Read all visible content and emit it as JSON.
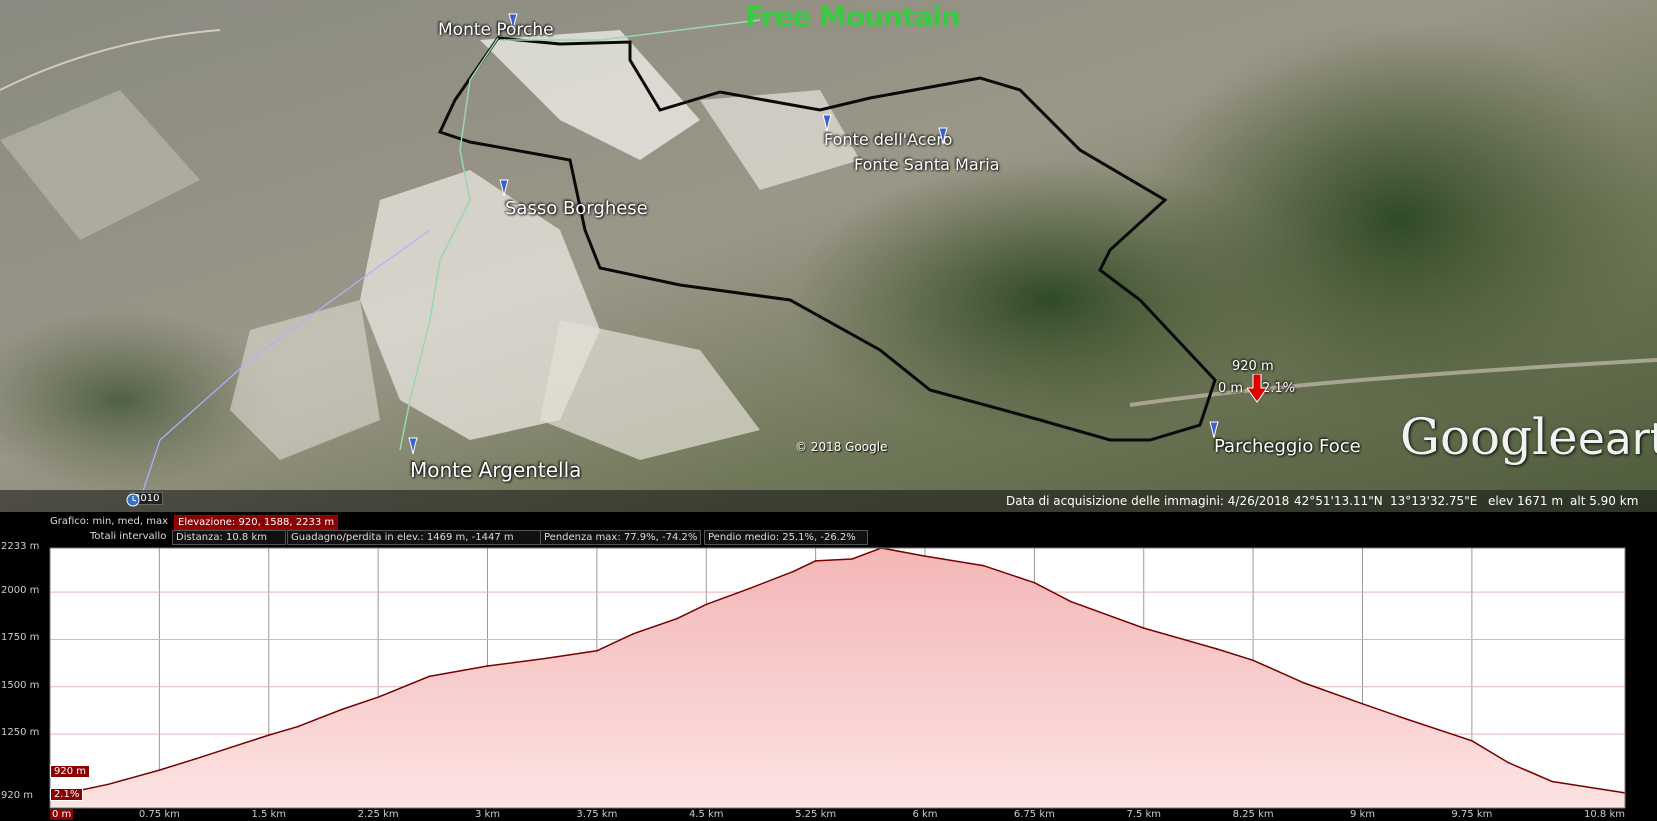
{
  "map": {
    "watermark": "Free Mountain",
    "copyright": "© 2018 Google",
    "logo": {
      "google": "Google",
      "earth": "earth"
    },
    "placemarks": [
      {
        "label": "Monte Porche"
      },
      {
        "label": "Fonte dell'Acero"
      },
      {
        "label": "Fonte Santa Maria"
      },
      {
        "label": "Sasso Borghese"
      },
      {
        "label": "Monte Argentella"
      },
      {
        "label": "Parcheggio Foce"
      }
    ],
    "cursor": {
      "elevation": "920 m",
      "distance": "0 m",
      "slope": "2.1%"
    },
    "history_year": "2010",
    "status": {
      "acquisition": "Data di acquisizione delle immagini: 4/26/2018",
      "lat": "42°51'13.11\"N",
      "lon": "13°13'32.75\"E",
      "elev": "elev  1671 m",
      "alt": "alt  5.90 km"
    }
  },
  "profile_header": {
    "grafico_label": "Grafico: min, med, max",
    "elevazione": "Elevazione: 920, 1588, 2233 m",
    "totali_label": "Totali intervallo",
    "distanza": "Distanza: 10.8 km",
    "guadagno": "Guadagno/perdita in elev.: 1469 m, -1447 m",
    "pendenza": "Pendenza max: 77.9%, -74.2%",
    "pendio": "Pendio medio: 25.1%, -26.2%"
  },
  "cursor_labels": {
    "elevation": "920 m",
    "slope": "2.1%"
  },
  "colors": {
    "profile_fill_top": "#f3b6b6",
    "profile_fill_bottom": "#fde3e3",
    "profile_line": "#7a0000",
    "accent_red": "#8b0000"
  },
  "chart_data": {
    "type": "area",
    "x_unit": "km",
    "y_unit": "m",
    "x": [
      0,
      0.4,
      0.75,
      1.0,
      1.5,
      1.7,
      2.0,
      2.25,
      2.6,
      3.0,
      3.4,
      3.75,
      4.0,
      4.3,
      4.5,
      4.8,
      5.1,
      5.25,
      5.5,
      5.7,
      6.0,
      6.4,
      6.75,
      7.0,
      7.5,
      8.0,
      8.25,
      8.6,
      9.0,
      9.3,
      9.75,
      10.0,
      10.3,
      10.8
    ],
    "y": [
      920,
      985,
      1060,
      1120,
      1245,
      1290,
      1380,
      1445,
      1555,
      1610,
      1650,
      1690,
      1780,
      1860,
      1935,
      2020,
      2110,
      2165,
      2175,
      2233,
      2190,
      2140,
      2050,
      1950,
      1810,
      1700,
      1640,
      1520,
      1410,
      1330,
      1215,
      1100,
      1000,
      940
    ],
    "xlim": [
      0,
      10.8
    ],
    "ylim": [
      860,
      2233
    ],
    "yticks": [
      "2233 m",
      "2000 m",
      "1750 m",
      "1500 m",
      "1250 m",
      "920 m"
    ],
    "ytick_values": [
      2233,
      2000,
      1750,
      1500,
      1250,
      920
    ],
    "xticks": [
      "0 m",
      "0.75 km",
      "1.5 km",
      "2.25 km",
      "3 km",
      "3.75 km",
      "4.5 km",
      "5.25 km",
      "6 km",
      "6.75 km",
      "7.5 km",
      "8.25 km",
      "9 km",
      "9.75 km",
      "10.8 km"
    ],
    "xtick_values": [
      0,
      0.75,
      1.5,
      2.25,
      3,
      3.75,
      4.5,
      5.25,
      6,
      6.75,
      7.5,
      8.25,
      9,
      9.75,
      10.8
    ],
    "grid": true
  }
}
